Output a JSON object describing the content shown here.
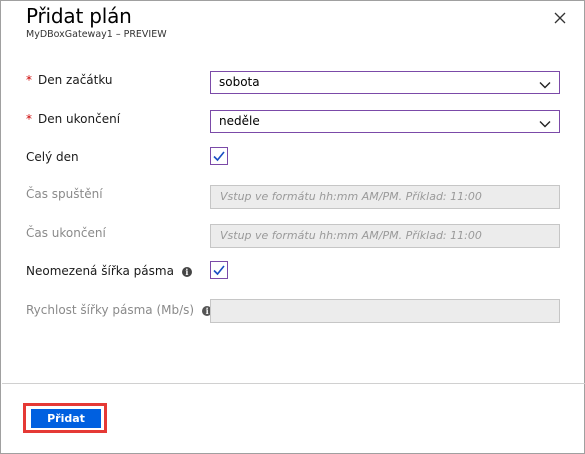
{
  "panel": {
    "title": "Přidat plán",
    "subtitle": "MyDBoxGateway1 – PREVIEW"
  },
  "form": {
    "start_day": {
      "label": "Den začátku",
      "required_mark": "*",
      "value": "sobota"
    },
    "end_day": {
      "label": "Den ukončení",
      "required_mark": "*",
      "value": "neděle"
    },
    "all_day": {
      "label": "Celý den",
      "checked": true
    },
    "start_time": {
      "label": "Čas spuštění",
      "placeholder": "Vstup ve formátu hh:mm AM/PM. Příklad: 11:00"
    },
    "end_time": {
      "label": "Čas ukončení",
      "placeholder": "Vstup ve formátu hh:mm AM/PM. Příklad: 11:00"
    },
    "unlimited_bandwidth": {
      "label": "Neomezená šířka pásma",
      "info": "i",
      "checked": true
    },
    "bandwidth_rate": {
      "label": "Rychlost šířky pásma (Mb/s)",
      "info": "i",
      "value": ""
    }
  },
  "footer": {
    "add_button": "Přidat"
  },
  "colors": {
    "accent_border": "#7b4aa8",
    "primary_button": "#0060e0",
    "highlight": "#e53935",
    "required": "#cc0000"
  },
  "icons": {
    "close": "close-icon",
    "chevron": "chevron-down-icon",
    "check": "checkmark-icon",
    "info": "info-icon"
  }
}
